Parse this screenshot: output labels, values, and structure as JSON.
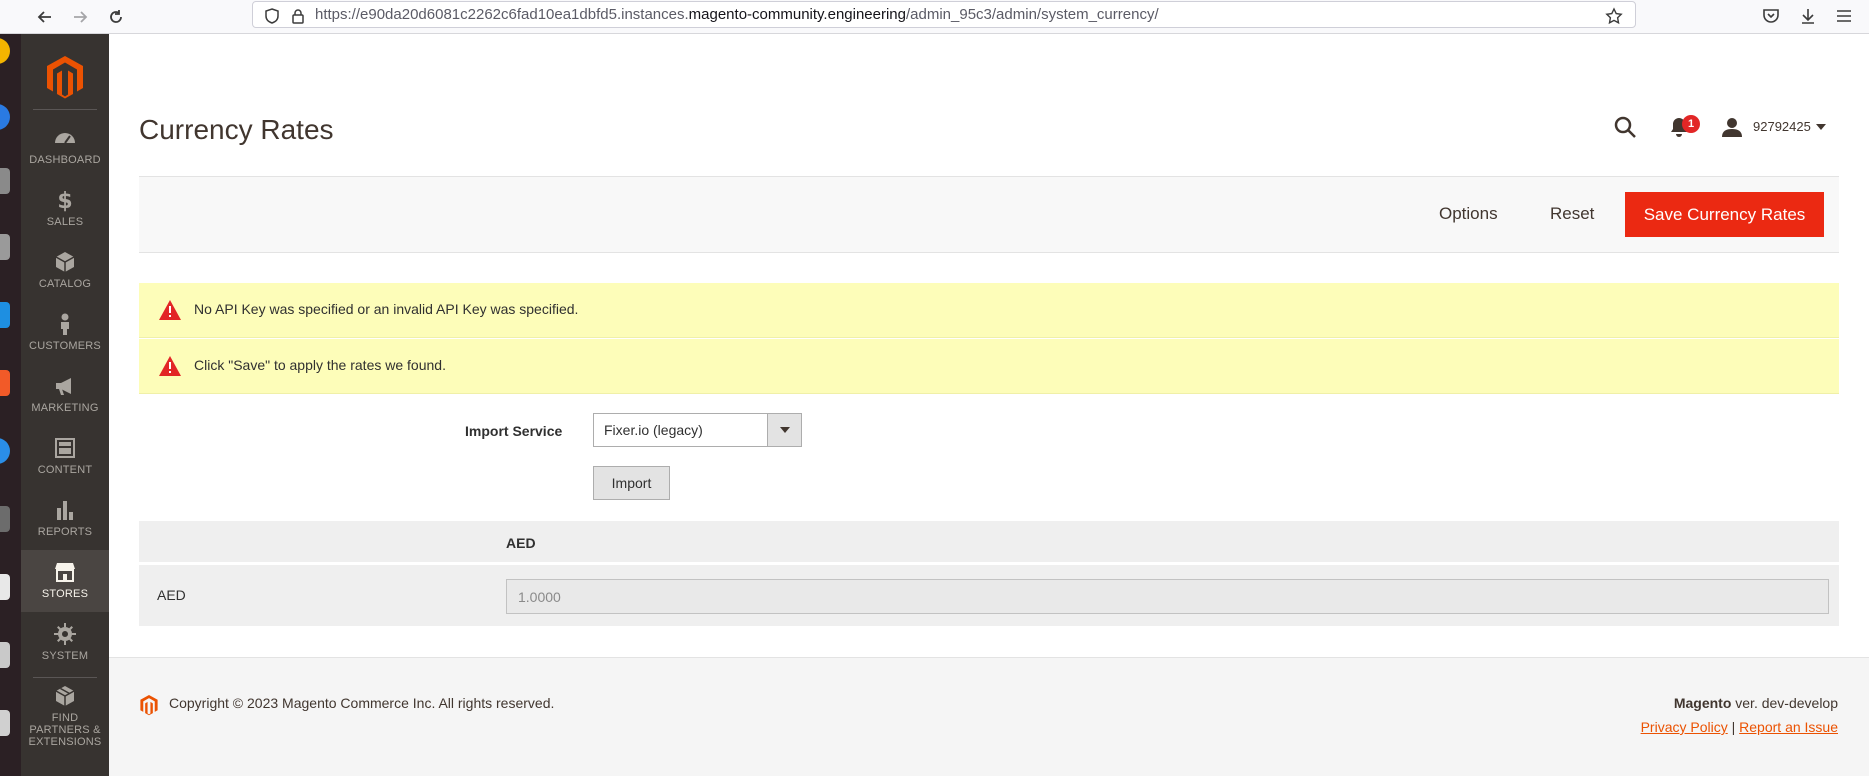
{
  "browser": {
    "url_prefix": "https://e90da20d6081c2262c6fad10ea1dbfd5.instances.",
    "url_domain": "magento-community.engineering",
    "url_path": "/admin_95c3/admin/system_currency/"
  },
  "sidebar": {
    "items": [
      {
        "label": "DASHBOARD",
        "icon": "dashboard-icon"
      },
      {
        "label": "SALES",
        "icon": "dollar-icon"
      },
      {
        "label": "CATALOG",
        "icon": "box-icon"
      },
      {
        "label": "CUSTOMERS",
        "icon": "person-icon"
      },
      {
        "label": "MARKETING",
        "icon": "megaphone-icon"
      },
      {
        "label": "CONTENT",
        "icon": "layout-icon"
      },
      {
        "label": "REPORTS",
        "icon": "bar-chart-icon"
      },
      {
        "label": "STORES",
        "icon": "store-icon"
      },
      {
        "label": "SYSTEM",
        "icon": "gear-icon"
      },
      {
        "label": "FIND PARTNERS & EXTENSIONS",
        "icon": "boxes-icon"
      }
    ],
    "active": "STORES"
  },
  "header": {
    "title": "Currency Rates",
    "notification_count": "1",
    "user_name": "92792425"
  },
  "actions": {
    "options_label": "Options",
    "reset_label": "Reset",
    "save_label": "Save Currency Rates"
  },
  "messages": [
    "No API Key was specified or an invalid API Key was specified.",
    "Click \"Save\" to apply the rates we found."
  ],
  "form": {
    "import_service_label": "Import Service",
    "import_service_value": "Fixer.io (legacy)",
    "import_button": "Import"
  },
  "table": {
    "column_header": "AED",
    "rows": [
      {
        "currency": "AED",
        "rate": "1.0000"
      }
    ]
  },
  "footer": {
    "copyright": "Copyright © 2023 Magento Commerce Inc. All rights reserved.",
    "brand": "Magento",
    "version": " ver. dev-develop",
    "privacy_link": "Privacy Policy",
    "separator": "|",
    "report_link": "Report an Issue"
  },
  "colors": {
    "accent": "#eb2912",
    "sidebar_bg": "#373330",
    "message_bg": "#fdfdb9"
  }
}
